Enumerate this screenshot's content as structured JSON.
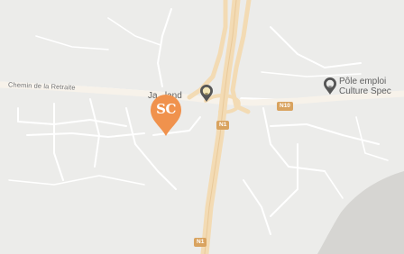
{
  "map": {
    "colors": {
      "land": "#ececea",
      "minor_road": "#ffffff",
      "national_road": "#f3dbb4",
      "water": "#d6d5d2",
      "shield": "#d9a35f",
      "brand_marker": "#f0924d",
      "poi_pin": "#555555"
    },
    "streets": [
      {
        "name": "Chemin de la Retraite"
      }
    ],
    "road_shields": [
      {
        "ref": "N1"
      },
      {
        "ref": "N10"
      },
      {
        "ref": "N1"
      }
    ],
    "pois": [
      {
        "text": "Ja...land",
        "icon": "lightbulb-pin-icon"
      },
      {
        "line1": "Pôle emploi",
        "line2": "Culture Spec",
        "icon": "lightbulb-pin-icon"
      }
    ],
    "brand_marker": {
      "label": "SC",
      "icon": "map-pin-icon"
    }
  }
}
